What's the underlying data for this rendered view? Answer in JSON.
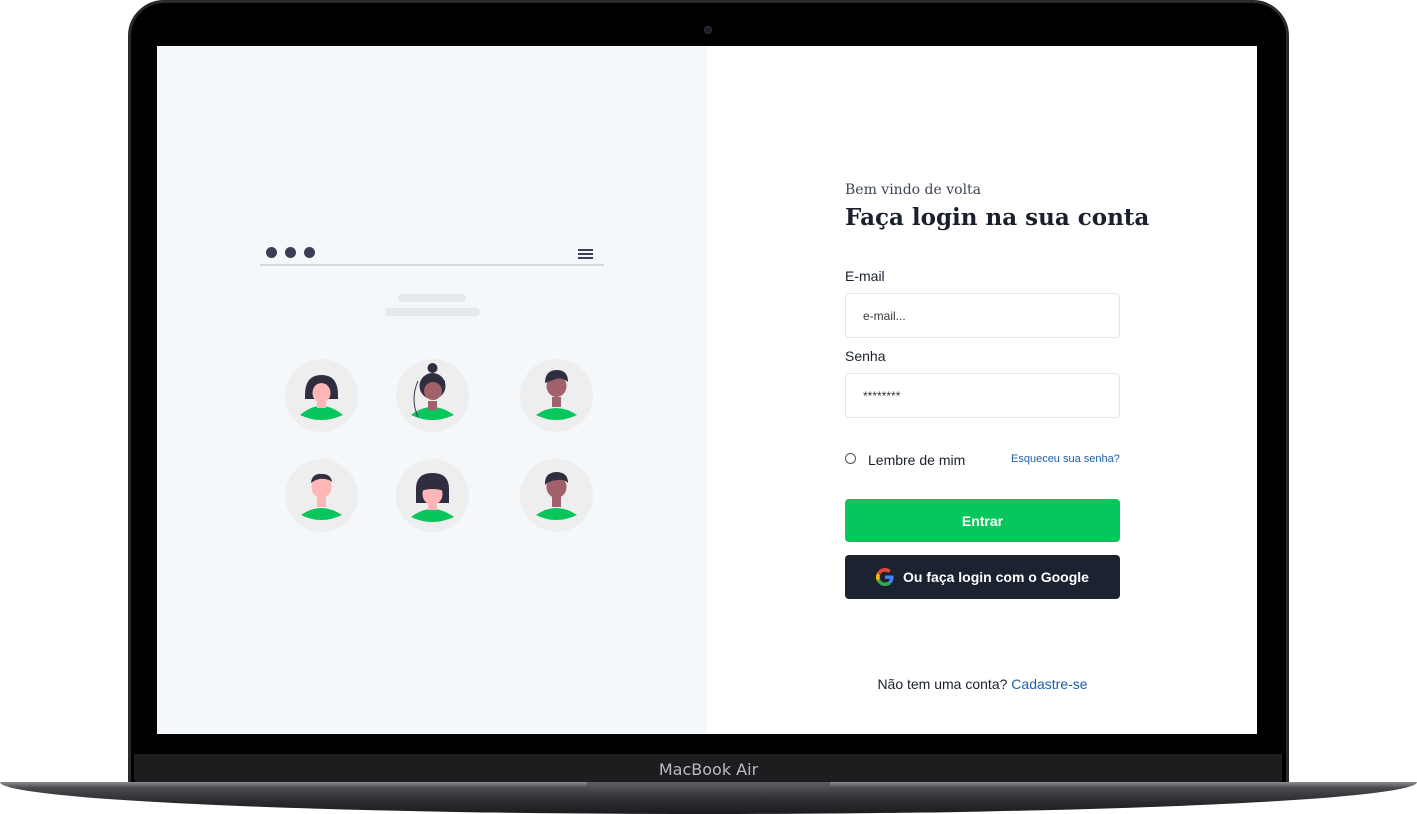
{
  "device": {
    "label": "MacBook Air"
  },
  "login": {
    "welcome": "Bem vindo de volta",
    "title": "Faça login na sua conta",
    "email_label": "E-mail",
    "email_placeholder": "e-mail...",
    "password_label": "Senha",
    "password_value": "********",
    "remember_label": "Lembre de mim",
    "forgot_link": "Esqueceu sua senha?",
    "submit_label": "Entrar",
    "google_label": "Ou faça login com o Google",
    "signup_prompt": "Não tem uma conta?",
    "signup_link": "Cadastre-se"
  },
  "illustration": {
    "avatars": [
      "woman-bob-avatar",
      "woman-bun-avatar",
      "man-curly-avatar",
      "man-short-hair-avatar",
      "woman-bangs-avatar",
      "man-swept-hair-avatar"
    ]
  },
  "colors": {
    "primary": "#06c65c",
    "dark_button": "#1b2230",
    "link": "#1f5fa8",
    "illustration_dark": "#3f3d56",
    "left_panel_bg": "#f5f8fb"
  }
}
